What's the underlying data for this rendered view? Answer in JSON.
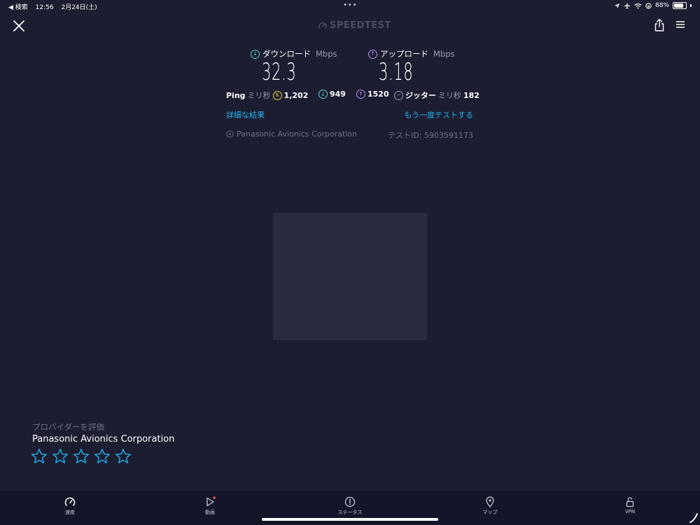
{
  "status_bar": {
    "back_label": "◀ 検索",
    "time": "12:56",
    "date": "2月24日(土)",
    "battery": "88%"
  },
  "header": {
    "title": "SPEEDTEST"
  },
  "download": {
    "label": "ダウンロード",
    "unit": "Mbps",
    "value": "32.3"
  },
  "upload": {
    "label": "アップロード",
    "unit": "Mbps",
    "value": "3.18"
  },
  "ping": {
    "label": "Ping",
    "unit": "ミリ秒",
    "idle": "1,202",
    "download": "949",
    "upload": "1520"
  },
  "jitter": {
    "label": "ジッター",
    "unit": "ミリ秒",
    "value": "182"
  },
  "links": {
    "details": "詳細な結果",
    "retest": "もう一度テストする"
  },
  "server": {
    "provider": "Panasonic Avionics Corporation",
    "test_id": "テストID: 5903591173"
  },
  "rating": {
    "label": "プロバイダーを評価",
    "provider": "Panasonic Avionics Corporation",
    "max_stars": 5,
    "selected": 0
  },
  "tabs": [
    {
      "label": "速度",
      "icon": "speedometer-icon"
    },
    {
      "label": "動画",
      "icon": "play-icon"
    },
    {
      "label": "ステータス",
      "icon": "alert-icon"
    },
    {
      "label": "マップ",
      "icon": "map-pin-icon"
    },
    {
      "label": "VPN",
      "icon": "lock-icon"
    }
  ],
  "colors": {
    "background": "#1c1d31",
    "accent_blue": "#1fb3ee",
    "download": "#4fd1c5",
    "upload": "#b78cf5",
    "ping_yellow": "#f2d24c"
  }
}
